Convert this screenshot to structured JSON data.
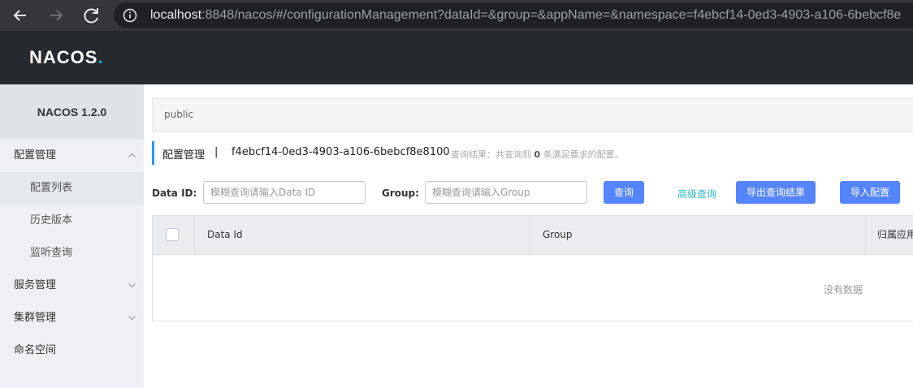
{
  "browser": {
    "url_host": "localhost",
    "url_rest": ":8848/nacos/#/configurationManagement?dataId=&group=&appName=&namespace=f4ebcf14-0ed3-4903-a106-6bebcf8e",
    "back_icon": "arrow-left-icon",
    "forward_icon": "arrow-right-icon",
    "reload_icon": "reload-icon",
    "info_icon": "info-icon"
  },
  "header": {
    "logo_text": "NACOS",
    "logo_dot": ".",
    "accent_color": "#11a9d1"
  },
  "sidebar": {
    "version": "NACOS 1.2.0",
    "items": [
      {
        "label": "配置管理",
        "expanded": true
      },
      {
        "label": "配置列表",
        "active": true
      },
      {
        "label": "历史版本"
      },
      {
        "label": "监听查询"
      },
      {
        "label": "服务管理",
        "expanded": false
      },
      {
        "label": "集群管理",
        "expanded": false
      },
      {
        "label": "命名空间"
      }
    ]
  },
  "main": {
    "namespace_tab": "public",
    "title": "配置管理",
    "separator": "|",
    "namespace_id": "f4ebcf14-0ed3-4903-a106-6bebcf8e8100",
    "result_prefix": "查询结果：共查询到",
    "result_count": "0",
    "result_suffix": "条满足要求的配置。",
    "query": {
      "data_id_label": "Data ID:",
      "data_id_placeholder": "模糊查询请输入Data ID",
      "group_label": "Group:",
      "group_placeholder": "模糊查询请输入Group",
      "search_label": "查询",
      "advanced_label": "高级查询",
      "export_label": "导出查询结果",
      "import_label": "导入配置"
    },
    "table": {
      "columns": [
        "Data Id",
        "Group",
        "归属应用"
      ],
      "empty_text": "没有数据"
    }
  },
  "colors": {
    "primary_button": "#5584ff",
    "link": "#2db7c5",
    "header_bg": "#252a2f",
    "title_accent": "#209bfa"
  }
}
